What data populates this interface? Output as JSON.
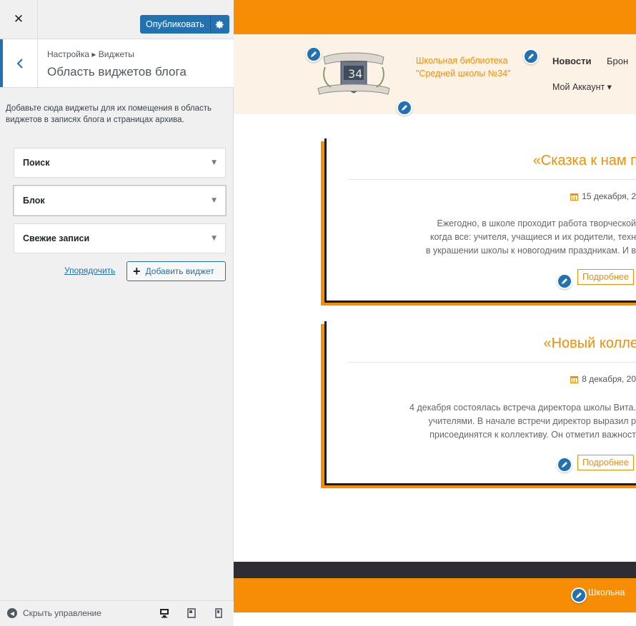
{
  "sidebar": {
    "close_icon": "✕",
    "publish_label": "Опубликовать",
    "breadcrumb": "Настройка ▸ Виджеты",
    "section_title": "Область виджетов блога",
    "description": "Добавьте сюда виджеты для их помещения в область виджетов в записях блога и страницах архива.",
    "widgets": [
      {
        "label": "Поиск"
      },
      {
        "label": "Блок"
      },
      {
        "label": "Свежие записи"
      }
    ],
    "reorder_label": "Упорядочить",
    "add_widget_label": "Добавить виджет",
    "hide_controls_label": "Скрыть управление"
  },
  "preview": {
    "site_title": "Школьная библиотека \"Средней школы №34\"",
    "nav": {
      "item_1": "Новости",
      "item_2": "Брон",
      "item_3": "Мой Аккаунт ▾"
    },
    "posts": [
      {
        "title": "«Сказка к нам п",
        "date": "15 декабря, 2",
        "lines": [
          "Ежегодно, в школе проходит работа творческой",
          "когда все: учителя, учащиеся и их родители, техн",
          "в украшении школы к новогодним праздникам. И в"
        ],
        "more_label": "Подробнее"
      },
      {
        "title": "«Новый колле",
        "date": "8 декабря, 20",
        "lines": [
          "4 декабря состоялась встреча директора школы Вита.",
          "учителями. В начале встречи директор выразил р",
          "присоединятся к коллективу. Он отметил важност"
        ],
        "more_label": "Подробнее"
      }
    ],
    "footer_text": "Школьна"
  },
  "colors": {
    "accent_blue": "#2271b1",
    "site_orange": "#f68d04",
    "footer_dark": "#2e2d33",
    "header_bg": "#fdf2e6"
  },
  "icons": [
    "close-icon",
    "gear-icon",
    "chevron-left-icon",
    "chevron-down-icon",
    "plus-icon",
    "pencil-icon",
    "calendar-icon",
    "desktop-icon",
    "tablet-icon",
    "mobile-icon",
    "collapse-arrow-icon"
  ]
}
